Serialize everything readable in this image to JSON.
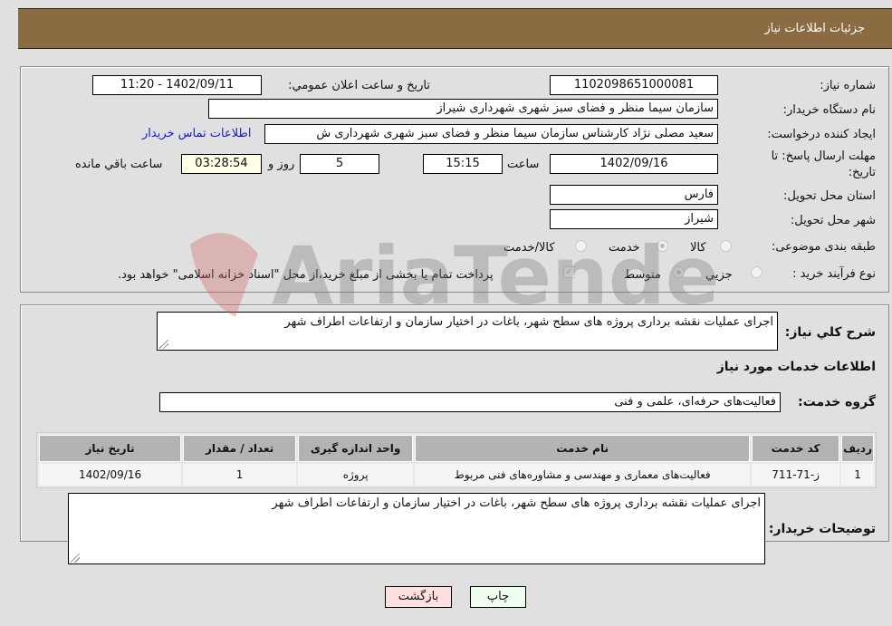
{
  "header": {
    "title": "جزئیات اطلاعات نیاز"
  },
  "details": {
    "need_number_label": "شماره نیاز:",
    "need_number": "1102098651000081",
    "announce_label": "تاریخ و ساعت اعلان عمومي:",
    "announce_value": "1402/09/11 - 11:20",
    "buyer_org_label": "نام دستگاه خریدار:",
    "buyer_org": "سازمان سیما منظر و فضای سبز شهری شهرداری شیراز",
    "creator_label": "ایجاد کننده درخواست:",
    "creator": "سعید مصلی نژاد کارشناس سازمان سیما منظر و فضای سبز شهری شهرداری ش",
    "contact_link": "اطلاعات تماس خریدار",
    "deadline_label_1": "مهلت ارسال پاسخ: تا",
    "deadline_label_2": "تاریخ:",
    "deadline_date": "1402/09/16",
    "hour_label": "ساعت",
    "deadline_time": "15:15",
    "days_value": "5",
    "days_label": "روز و",
    "remaining_time": "03:28:54",
    "remaining_label": "ساعت باقي مانده",
    "province_label": "استان محل تحویل:",
    "province": "فارس",
    "city_label": "شهر محل تحویل:",
    "city": "شیراز",
    "category_label": "طبقه بندی موضوعی:",
    "category_options": [
      {
        "label": "کالا",
        "checked": false
      },
      {
        "label": "خدمت",
        "checked": true
      },
      {
        "label": "کالا/خدمت",
        "checked": false
      }
    ],
    "process_label": "نوع فرآیند خرید :",
    "process_options": [
      {
        "label": "جزيي",
        "checked": false
      },
      {
        "label": "متوسط",
        "checked": true
      }
    ],
    "treasury_note": "پرداخت تمام یا بخشی از مبلغ خرید،از محل \"اسناد خزانه اسلامی\" خواهد بود."
  },
  "description": {
    "label": "شرح کلي نياز:",
    "value": "اجرای عملیات نقشه برداری پروژه های سطح شهر، باغات در اختیار سازمان و ارتفاعات اطراف شهر"
  },
  "services_section": {
    "title": "اطلاعات خدمات مورد نیاز",
    "group_label": "گروه خدمت:",
    "group_value": "فعالیت‌های حرفه‌ای، علمی و فنی"
  },
  "table": {
    "columns": [
      "ردیف",
      "کد خدمت",
      "نام خدمت",
      "واحد اندازه گیری",
      "تعداد / مقدار",
      "تاریخ نیاز"
    ],
    "rows": [
      [
        "1",
        "ز-71-711",
        "فعالیت‌های معماری و مهندسی و مشاوره‌های فنی مربوط",
        "پروژه",
        "1",
        "1402/09/16"
      ]
    ]
  },
  "buyer_notes": {
    "label": "توضیحات خریدار:",
    "value": "اجرای عملیات نقشه برداری پروژه های سطح شهر، باغات در اختیار سازمان و ارتفاعات اطراف شهر"
  },
  "buttons": {
    "print": "چاپ",
    "back": "بازگشت"
  },
  "watermark": {
    "text": "AriaTender.neT"
  }
}
